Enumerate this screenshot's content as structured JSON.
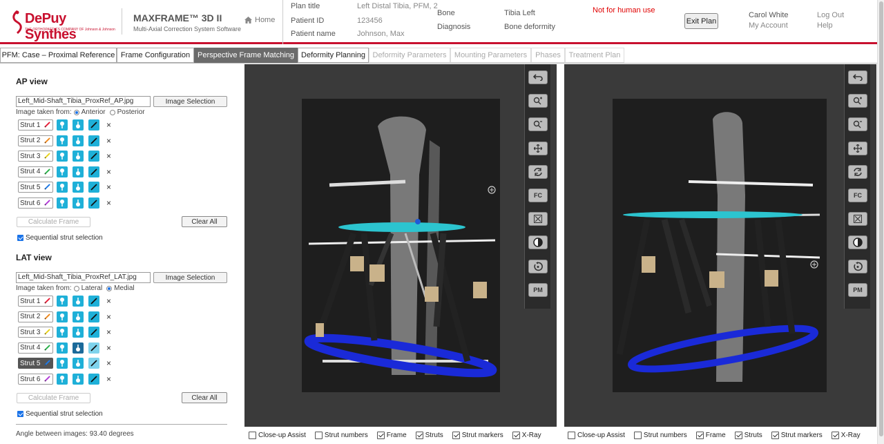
{
  "brand": {
    "name": "DePuy Synthes",
    "tagline": "THE ORTHOPAEDICS COMPANY OF Johnson & Johnson"
  },
  "product": {
    "title": "MAXFRAME™ 3D II",
    "subtitle": "Multi-Axial Correction System Software"
  },
  "nav": {
    "home_label": "Home",
    "exit_plan": "Exit Plan",
    "warning": "Not for human use"
  },
  "plan": {
    "title_label": "Plan title",
    "title_value": "Left Distal Tibia, PFM, 2",
    "id_label": "Patient ID",
    "id_value": "123456",
    "name_label": "Patient name",
    "name_value": "Johnson, Max",
    "bone_label": "Bone",
    "bone_value": "Tibia Left",
    "diagnosis_label": "Diagnosis",
    "diagnosis_value": "Bone deformity"
  },
  "user": {
    "name": "Carol White",
    "account": "My Account",
    "logout": "Log Out",
    "help": "Help"
  },
  "tabs": [
    {
      "label": "PFM: Case – Proximal Reference"
    },
    {
      "label": "Frame Configuration"
    },
    {
      "label": "Perspective Frame Matching"
    },
    {
      "label": "Deformity Planning"
    },
    {
      "label": "Deformity Parameters"
    },
    {
      "label": "Mounting Parameters"
    },
    {
      "label": "Phases"
    },
    {
      "label": "Treatment Plan"
    }
  ],
  "ap": {
    "heading": "AP view",
    "filename": "Left_Mid-Shaft_Tibia_ProxRef_AP.jpg",
    "image_selection": "Image Selection",
    "taken_from_label": "Image taken from:",
    "opt1": "Anterior",
    "opt2": "Posterior",
    "struts": [
      "Strut 1",
      "Strut 2",
      "Strut 3",
      "Strut 4",
      "Strut 5",
      "Strut 6"
    ],
    "calculate": "Calculate Frame",
    "clear": "Clear All",
    "sequential": "Sequential strut selection"
  },
  "lat": {
    "heading": "LAT view",
    "filename": "Left_Mid-Shaft_Tibia_ProxRef_LAT.jpg",
    "image_selection": "Image Selection",
    "taken_from_label": "Image taken from:",
    "opt1": "Lateral",
    "opt2": "Medial",
    "struts": [
      "Strut 1",
      "Strut 2",
      "Strut 3",
      "Strut 4",
      "Strut 5",
      "Strut 6"
    ],
    "calculate": "Calculate Frame",
    "clear": "Clear All",
    "sequential": "Sequential strut selection"
  },
  "angle_text": "Angle between images: 93.40 degrees",
  "toolbar": {
    "fc": "FC",
    "pm": "PM"
  },
  "view_options": [
    "Close-up Assist",
    "Strut numbers",
    "Frame",
    "Struts",
    "Strut markers",
    "X-Ray"
  ],
  "strut_colors": [
    "#e8203a",
    "#f08a1e",
    "#e8d21e",
    "#2ab34a",
    "#1e7be8",
    "#b23cd8"
  ],
  "colors": {
    "brand": "#c8102e",
    "accent": "#1fb0d8",
    "warning": "#e00000"
  }
}
